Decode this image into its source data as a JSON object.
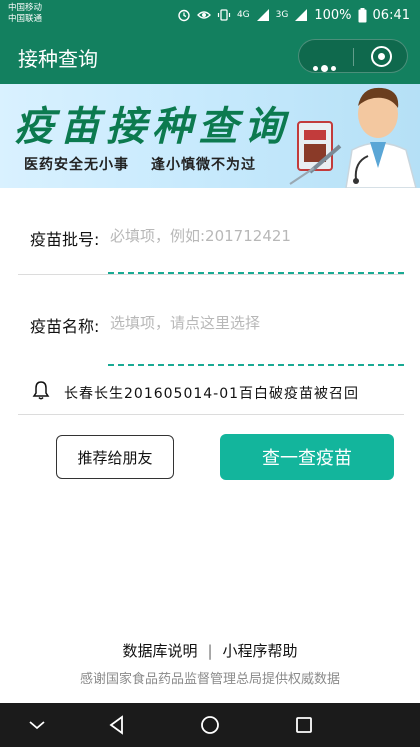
{
  "status_bar": {
    "carrier_1": "中国移动",
    "carrier_2": "中国联通",
    "network_1": "4G",
    "network_2": "3G",
    "battery": "100%",
    "time": "06:41"
  },
  "title_bar": {
    "title": "接种查询",
    "menu_icon": "more-dots-icon",
    "close_icon": "target-close-icon"
  },
  "banner": {
    "title": "疫苗接种查询",
    "slogan_left": "医药安全无小事",
    "slogan_right": "逢小慎微不为过"
  },
  "form": {
    "batch": {
      "label": "疫苗批号:",
      "value": "",
      "placeholder": "必填项，例如:201712421"
    },
    "name": {
      "label": "疫苗名称:",
      "value": "",
      "placeholder": "选填项，请点这里选择"
    }
  },
  "notice": {
    "icon": "bell-icon",
    "text": "长春长生201605014-01百白破疫苗被召回"
  },
  "actions": {
    "share_label": "推荐给朋友",
    "query_label": "查一查疫苗"
  },
  "footer": {
    "link_db": "数据库说明",
    "separator": "|",
    "link_help": "小程序帮助",
    "credit": "感谢国家食品药品监督管理总局提供权威数据"
  },
  "colors": {
    "header_green": "#13805f",
    "accent_teal": "#13b59c",
    "dash_teal": "#1aaa94"
  }
}
